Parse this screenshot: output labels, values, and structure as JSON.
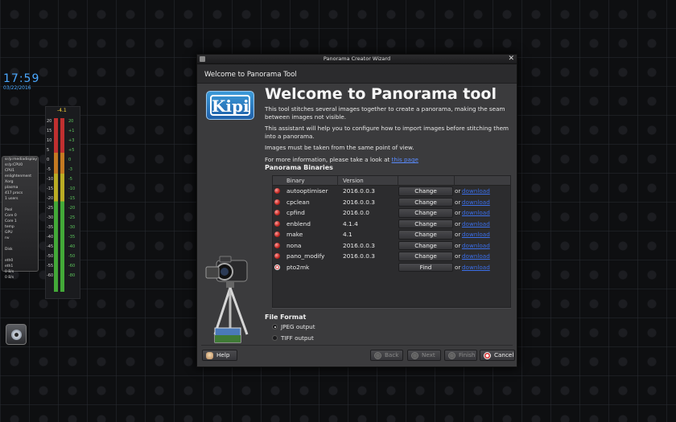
{
  "desktop": {
    "clock": "17:59",
    "date": "03/22/2016",
    "vu_top": "-4.1",
    "vu_left_scale": [
      "20",
      "15",
      "10",
      "5",
      "0",
      "-5",
      "-10",
      "-15",
      "-20",
      "-25",
      "-30",
      "-35",
      "-40",
      "-45",
      "-50",
      "-55",
      "-60"
    ],
    "vu_right_scale": [
      "20",
      "+1",
      "+3",
      "+5",
      "0",
      "-3",
      "-5",
      "-10",
      "-15",
      "-20",
      "-25",
      "-30",
      "-35",
      "-40",
      "-50",
      "-60",
      "-80"
    ],
    "sysmon_lines": [
      "sr/p:mediadisplay",
      "sr/p:CPU0",
      "CPU1",
      "enlightenment",
      "Xorg",
      "plasma",
      "417 procs",
      "1 users",
      "",
      "Pool",
      "Core 0",
      "Core 1",
      "temp",
      "GPU",
      "nv",
      "",
      "Disk",
      "",
      "eth0",
      "eth1",
      "0 B/s",
      "0 B/s"
    ]
  },
  "window": {
    "title": "Panorama Creator Wizard",
    "close_symbol": "✕",
    "page_header": "Welcome to Panorama Tool",
    "logo_text": "Kipi",
    "main_title": "Welcome to Panorama tool",
    "intro_1": "This tool stitches several images together to create a panorama, making the seam between images not visible.",
    "intro_2": "This assistant will help you to configure how to import images before stitching them into a panorama.",
    "intro_3": "Images must be taken from the same point of view.",
    "more_info_prefix": "For more information, please take a look at ",
    "more_info_link": "this page",
    "binaries_title": "Panorama Binaries",
    "table": {
      "col_binary": "Binary",
      "col_version": "Version",
      "or_text": "or",
      "download_text": "download",
      "rows": [
        {
          "name": "autooptimiser",
          "version": "2016.0.0.3",
          "action": "Change",
          "status": "found"
        },
        {
          "name": "cpclean",
          "version": "2016.0.0.3",
          "action": "Change",
          "status": "found"
        },
        {
          "name": "cpfind",
          "version": "2016.0.0",
          "action": "Change",
          "status": "found"
        },
        {
          "name": "enblend",
          "version": "4.1.4",
          "action": "Change",
          "status": "found"
        },
        {
          "name": "make",
          "version": "4.1",
          "action": "Change",
          "status": "found"
        },
        {
          "name": "nona",
          "version": "2016.0.0.3",
          "action": "Change",
          "status": "found"
        },
        {
          "name": "pano_modify",
          "version": "2016.0.0.3",
          "action": "Change",
          "status": "found"
        },
        {
          "name": "pto2mk",
          "version": "",
          "action": "Find",
          "status": "missing"
        }
      ]
    },
    "file_format_title": "File Format",
    "formats": [
      {
        "label": "JPEG output",
        "selected": true
      },
      {
        "label": "TIFF output",
        "selected": false
      }
    ],
    "buttons": {
      "help": "Help",
      "back": "Back",
      "next": "Next",
      "finish": "Finish",
      "cancel": "Cancel"
    }
  }
}
